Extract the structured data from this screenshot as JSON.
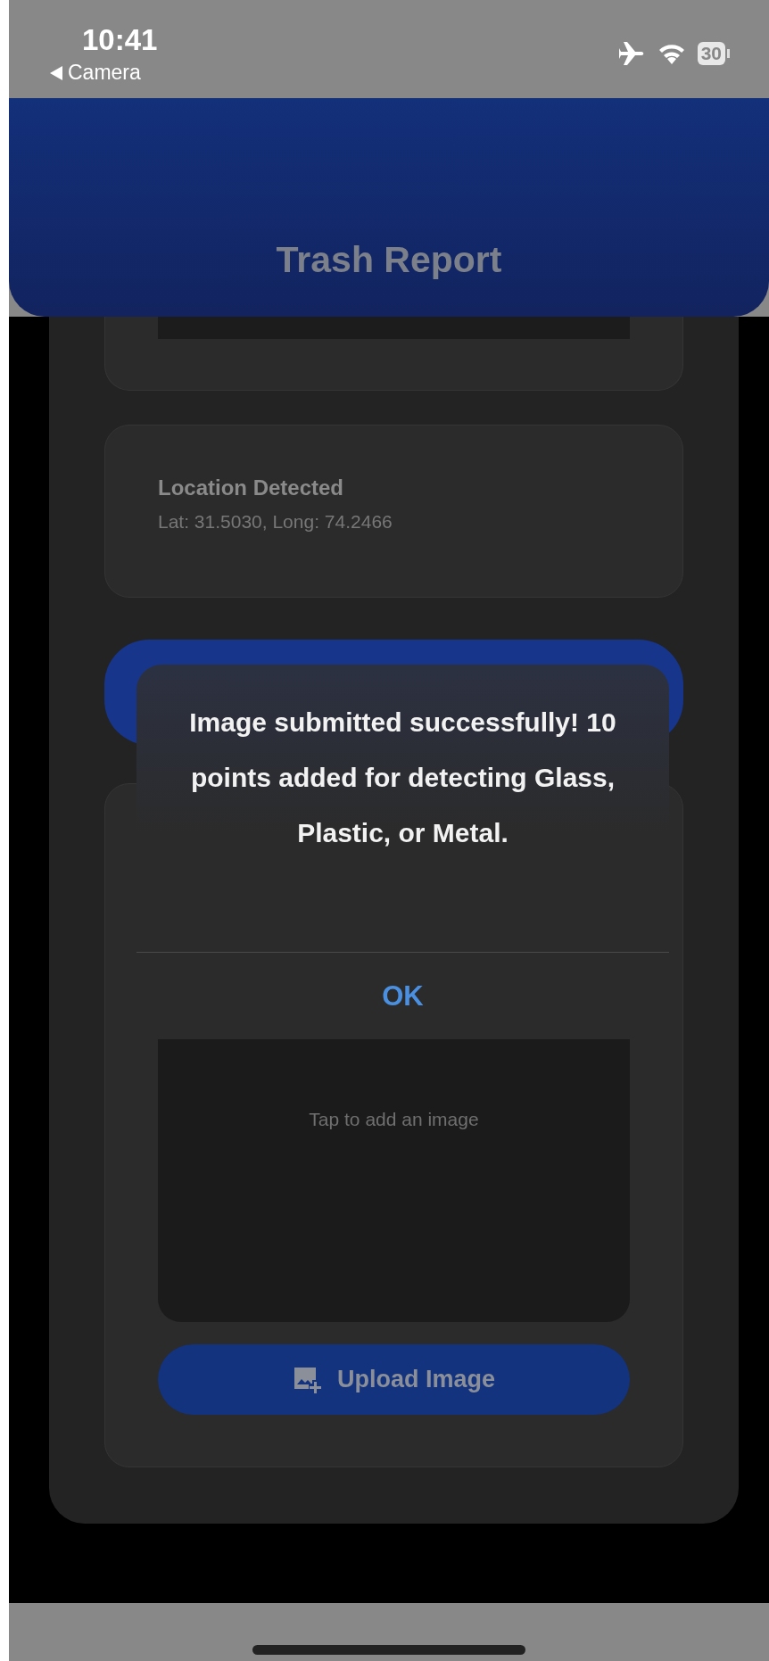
{
  "status_bar": {
    "time": "10:41",
    "back_label": "Camera",
    "battery": "30"
  },
  "header": {
    "title": "Trash Report"
  },
  "location_card": {
    "title": "Location Detected",
    "coordinates": "Lat: 31.5030, Long: 74.2466"
  },
  "image_picker": {
    "placeholder": "Tap to add an image"
  },
  "upload_button": {
    "label": "Upload Image"
  },
  "alert": {
    "message": "Image submitted successfully! 10 points added for detecting Glass, Plastic, or Metal.",
    "button": "OK"
  }
}
